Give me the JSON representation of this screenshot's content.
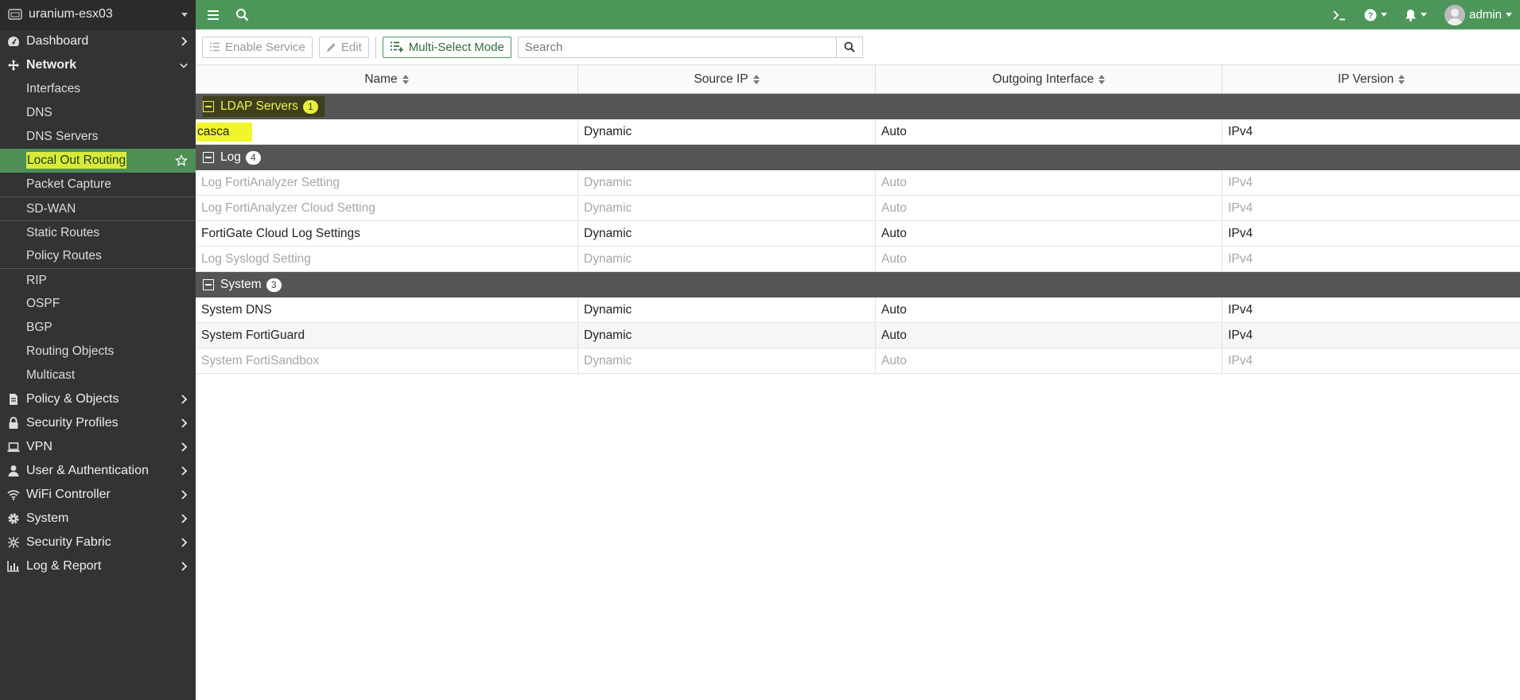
{
  "device": {
    "name": "uranium-esx03"
  },
  "sidebar": {
    "top_items": [
      {
        "label": "Dashboard",
        "icon": "dashboard-icon"
      },
      {
        "label": "Network",
        "icon": "network-icon"
      }
    ],
    "network_sub": [
      {
        "label": "Interfaces"
      },
      {
        "label": "DNS"
      },
      {
        "label": "DNS Servers"
      },
      {
        "label": "Local Out Routing"
      },
      {
        "label": "Packet Capture"
      },
      {
        "label": "SD-WAN"
      },
      {
        "label": "Static Routes"
      },
      {
        "label": "Policy Routes"
      },
      {
        "label": "RIP"
      },
      {
        "label": "OSPF"
      },
      {
        "label": "BGP"
      },
      {
        "label": "Routing Objects"
      },
      {
        "label": "Multicast"
      }
    ],
    "bottom_items": [
      {
        "label": "Policy & Objects",
        "icon": "policy-icon"
      },
      {
        "label": "Security Profiles",
        "icon": "lock-icon"
      },
      {
        "label": "VPN",
        "icon": "laptop-icon"
      },
      {
        "label": "User & Authentication",
        "icon": "user-icon"
      },
      {
        "label": "WiFi Controller",
        "icon": "wifi-icon"
      },
      {
        "label": "System",
        "icon": "gear-icon"
      },
      {
        "label": "Security Fabric",
        "icon": "fabric-icon"
      },
      {
        "label": "Log & Report",
        "icon": "chart-icon"
      }
    ]
  },
  "topbar": {
    "user": "admin"
  },
  "toolbar": {
    "enable_service": "Enable Service",
    "edit": "Edit",
    "multi_select": "Multi-Select Mode",
    "search_placeholder": "Search"
  },
  "table": {
    "columns": [
      "Name",
      "Source IP",
      "Outgoing Interface",
      "IP Version"
    ],
    "groups": [
      {
        "name": "LDAP Servers",
        "count": "1",
        "rows": [
          {
            "name": "casca",
            "source": "Dynamic",
            "iface": "Auto",
            "ipver": "IPv4"
          }
        ]
      },
      {
        "name": "Log",
        "count": "4",
        "rows": [
          {
            "name": "Log FortiAnalyzer Setting",
            "source": "Dynamic",
            "iface": "Auto",
            "ipver": "IPv4"
          },
          {
            "name": "Log FortiAnalyzer Cloud Setting",
            "source": "Dynamic",
            "iface": "Auto",
            "ipver": "IPv4"
          },
          {
            "name": "FortiGate Cloud Log Settings",
            "source": "Dynamic",
            "iface": "Auto",
            "ipver": "IPv4"
          },
          {
            "name": "Log Syslogd Setting",
            "source": "Dynamic",
            "iface": "Auto",
            "ipver": "IPv4"
          }
        ]
      },
      {
        "name": "System",
        "count": "3",
        "rows": [
          {
            "name": "System DNS",
            "source": "Dynamic",
            "iface": "Auto",
            "ipver": "IPv4"
          },
          {
            "name": "System FortiGuard",
            "source": "Dynamic",
            "iface": "Auto",
            "ipver": "IPv4"
          },
          {
            "name": "System FortiSandbox",
            "source": "Dynamic",
            "iface": "Auto",
            "ipver": "IPv4"
          }
        ]
      }
    ]
  },
  "colors": {
    "brand_green": "#4d965a",
    "sidebar_bg": "#333333",
    "highlight": "#f1f52b",
    "group_bg": "#555555"
  }
}
